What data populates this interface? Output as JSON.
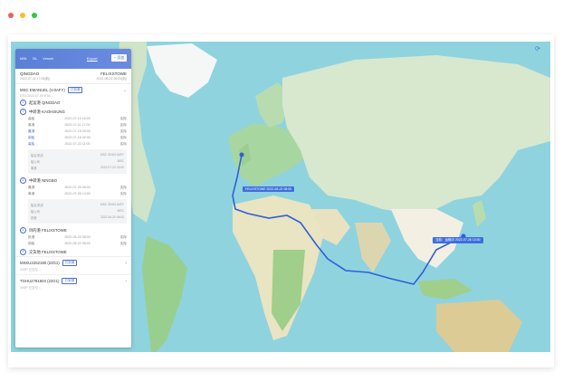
{
  "window": {
    "dot_colors": [
      "#f25f58",
      "#fbbd2e",
      "#2ec840"
    ]
  },
  "panel": {
    "tabs": [
      "MBL",
      "BL",
      "Vessel"
    ],
    "link": "Export",
    "button": "+ 添加",
    "origin": {
      "port": "QINGDAO",
      "date": "2022-07-11 17:00(航)"
    },
    "destination": {
      "port": "FELIXSTOWE",
      "date": "2022-08-22 08:00(航)"
    },
    "vessel1": {
      "name": "MSC EMANUEL (V.0AFY)",
      "badge": "已到港",
      "sub": "ETD:2022-07-09 ETA:..."
    },
    "stops": [
      {
        "num": "1",
        "name": "起运港 QINGDAO"
      },
      {
        "num": "2",
        "name": "中转港 KAOHSIUNG"
      },
      {
        "num": "3",
        "name": "中转港 NINGBO"
      },
      {
        "num": "4",
        "name": "目的港 FELIXSTOWE"
      },
      {
        "num": "5",
        "name": "交货地 FELIXSTOWE"
      }
    ],
    "events_a": [
      {
        "label": "装船",
        "date": "2022-07-10 18:00",
        "tag": "实际"
      },
      {
        "label": "离港",
        "date": "2022-07-11 17:00",
        "tag": "实际"
      },
      {
        "label": "靠港",
        "date": "2022-07-15 09:00",
        "tag": "实际"
      },
      {
        "label": "卸船",
        "date": "2022-07-16 02:00",
        "tag": "实际"
      },
      {
        "label": "装船",
        "date": "2022-07-22 11:00",
        "tag": "实际"
      }
    ],
    "box_a": [
      {
        "k": "船名/航次",
        "v": "MSC SIXIN 0AFY"
      },
      {
        "k": "船公司",
        "v": "MSC"
      },
      {
        "k": "离港",
        "v": "2022-07-22 23:00"
      }
    ],
    "events_b": [
      {
        "label": "靠港",
        "date": "2022-07-25 06:00",
        "tag": "实际"
      },
      {
        "label": "离港",
        "date": "2022-07-26 13:00",
        "tag": "实际"
      }
    ],
    "box_b": [
      {
        "k": "船名/航次",
        "v": "MSC SIXIN 0AFY"
      },
      {
        "k": "船公司",
        "v": "MSC"
      },
      {
        "k": "抵港",
        "v": "2022-08-20 06:00"
      }
    ],
    "events_c": [
      {
        "label": "抵港",
        "date": "2022-08-20 08:00",
        "tag": "实际"
      },
      {
        "label": "卸船",
        "date": "2022-08-22 08:00",
        "tag": "实际"
      }
    ],
    "footer": [
      {
        "name": "MSKU2262190 (22G1)",
        "badge": "已到港",
        "sub": "20GP 已交付 ..."
      },
      {
        "name": "TGHU2781604 (22G1)",
        "badge": "已到港",
        "sub": "20GP 已交付 ..."
      }
    ]
  },
  "map": {
    "tip_europe": "FELIXSTOWE 2022-08-22 08:00",
    "tip_asia": "当前：运输中 2022-07-26 13:00"
  }
}
